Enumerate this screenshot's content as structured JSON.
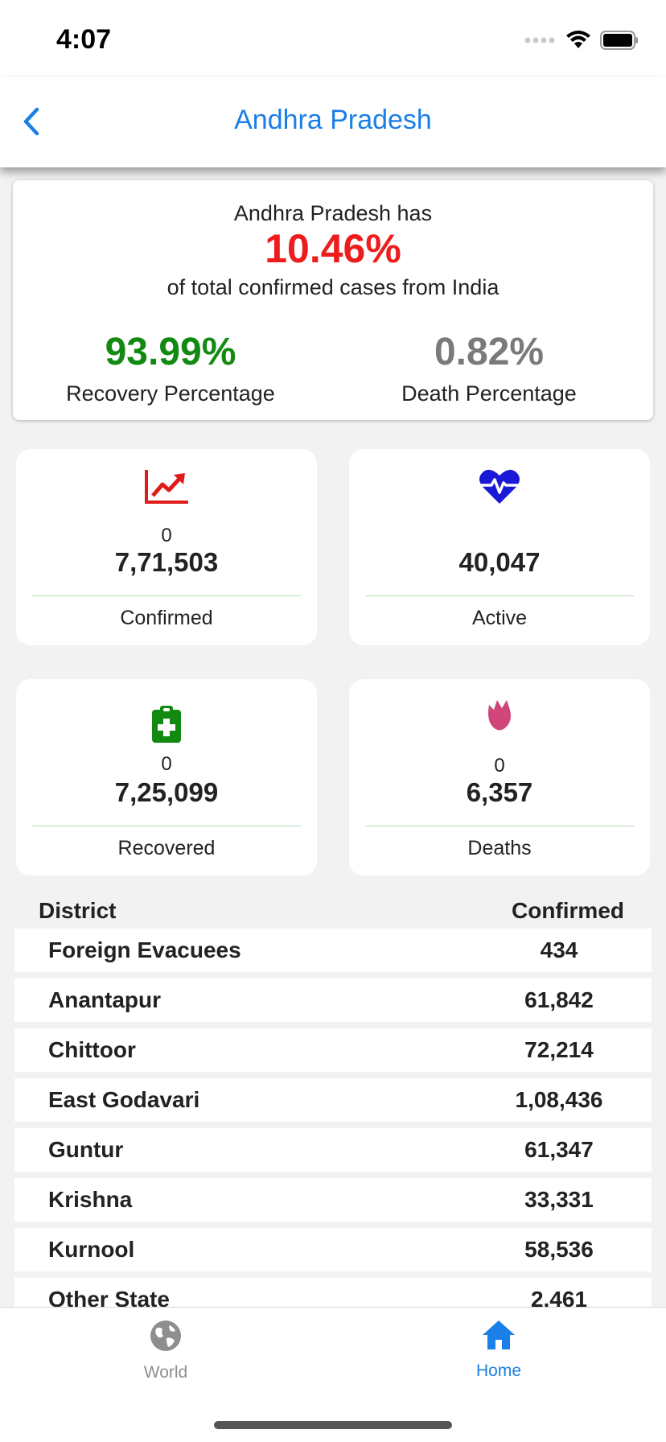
{
  "status_bar": {
    "time": "4:07"
  },
  "nav": {
    "title": "Andhra Pradesh"
  },
  "summary": {
    "line1": "Andhra Pradesh has",
    "percent_of_india": "10.46%",
    "line2": "of total confirmed cases from India",
    "recovery_percent": "93.99%",
    "recovery_label": "Recovery Percentage",
    "death_percent": "0.82%",
    "death_label": "Death Percentage"
  },
  "stats": {
    "confirmed": {
      "delta": "0",
      "value": "7,71,503",
      "label": "Confirmed",
      "icon": "trend-up-icon",
      "color": "#e01b1b"
    },
    "active": {
      "delta": "",
      "value": "40,047",
      "label": "Active",
      "icon": "heartbeat-icon",
      "color": "#1a1ad6"
    },
    "recovered": {
      "delta": "0",
      "value": "7,25,099",
      "label": "Recovered",
      "icon": "medical-clipboard-icon",
      "color": "#128a12"
    },
    "deaths": {
      "delta": "0",
      "value": "6,357",
      "label": "Deaths",
      "icon": "rose-icon",
      "color": "#d0467a"
    }
  },
  "table": {
    "header": {
      "district": "District",
      "confirmed": "Confirmed"
    },
    "rows": [
      {
        "district": "Foreign Evacuees",
        "confirmed": "434"
      },
      {
        "district": "Anantapur",
        "confirmed": "61,842"
      },
      {
        "district": "Chittoor",
        "confirmed": "72,214"
      },
      {
        "district": "East Godavari",
        "confirmed": "1,08,436"
      },
      {
        "district": "Guntur",
        "confirmed": "61,347"
      },
      {
        "district": "Krishna",
        "confirmed": "33,331"
      },
      {
        "district": "Kurnool",
        "confirmed": "58,536"
      },
      {
        "district": "Other State",
        "confirmed": "2,461"
      }
    ]
  },
  "tabs": {
    "world": {
      "label": "World",
      "icon": "globe-icon",
      "color": "#8e8e8e"
    },
    "home": {
      "label": "Home",
      "icon": "house-icon",
      "color": "#1a7fe6"
    }
  }
}
